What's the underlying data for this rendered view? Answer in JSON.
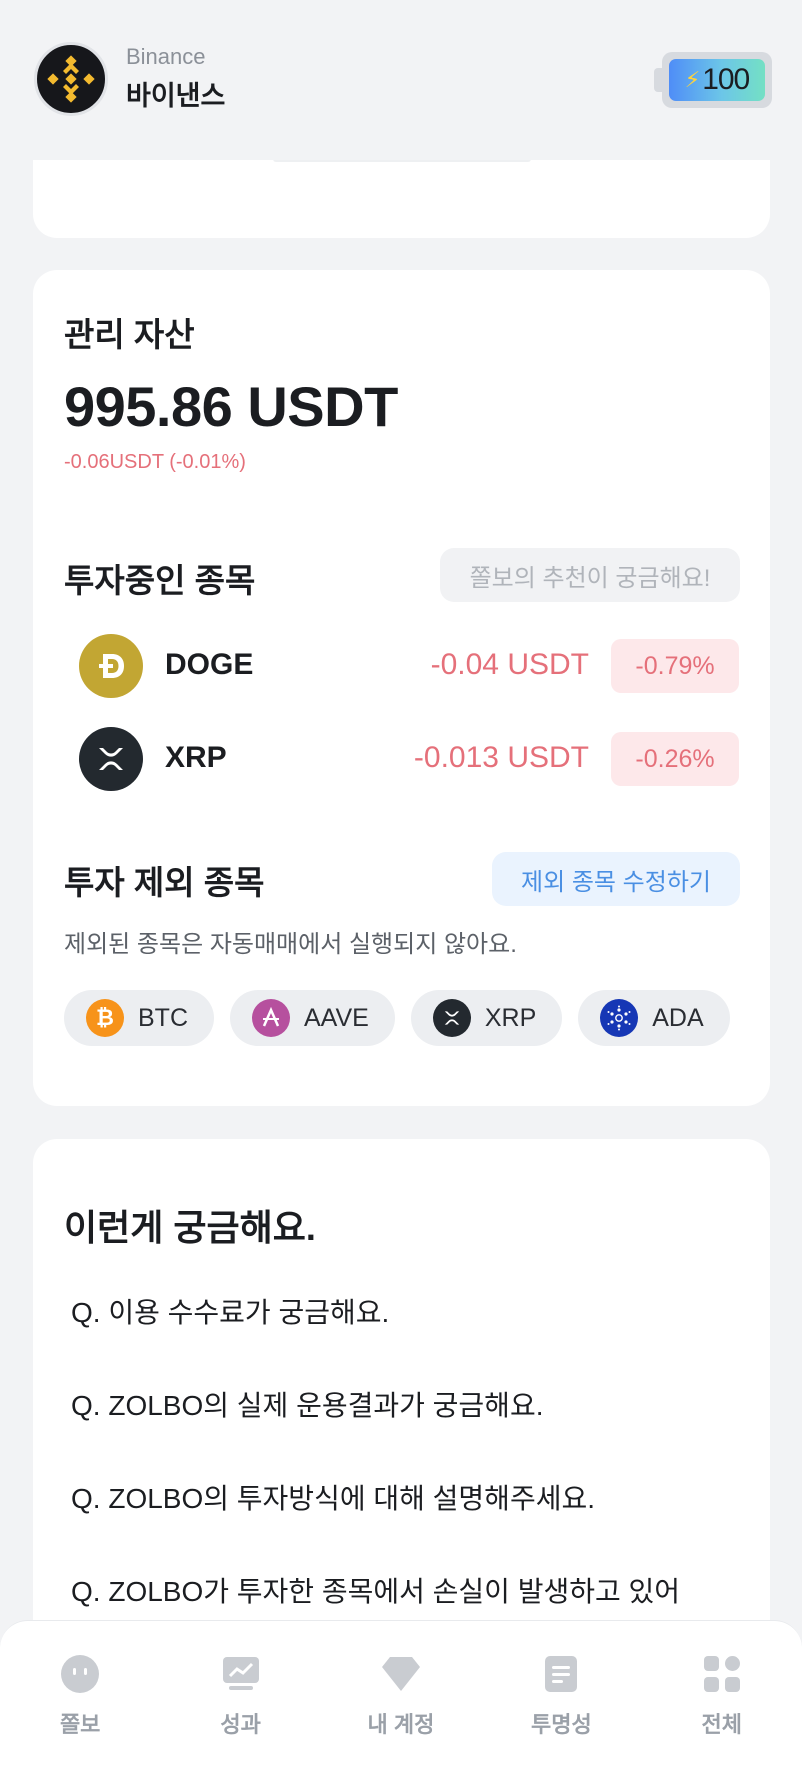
{
  "header": {
    "exchange_en": "Binance",
    "exchange_ko": "바이낸스",
    "energy_value": "100",
    "colors": {
      "brand": "#f3ba2f",
      "energy_start": "#4f8df7",
      "energy_end": "#74e0c4"
    }
  },
  "assets": {
    "title": "관리 자산",
    "amount": "995.86 USDT",
    "change": "-0.06USDT (-0.01%)"
  },
  "investing": {
    "title": "투자중인 종목",
    "recommend_button": "쫄보의 추천이 궁금해요!",
    "coins": [
      {
        "name": "DOGE",
        "amount": "-0.04 USDT",
        "percent": "-0.79%",
        "icon": "doge-icon"
      },
      {
        "name": "XRP",
        "amount": "-0.013 USDT",
        "percent": "-0.26%",
        "icon": "xrp-icon"
      }
    ],
    "negative_color": "#e5707a"
  },
  "excluded": {
    "title": "투자 제외 종목",
    "edit_button": "제외 종목 수정하기",
    "description": "제외된 종목은 자동매매에서 실행되지 않아요.",
    "chips": [
      {
        "label": "BTC",
        "icon": "btc-icon"
      },
      {
        "label": "AAVE",
        "icon": "aave-icon"
      },
      {
        "label": "XRP",
        "icon": "xrp-icon"
      },
      {
        "label": "ADA",
        "icon": "ada-icon"
      }
    ]
  },
  "faq": {
    "title": "이런게 궁금해요.",
    "items": [
      "Q. 이용 수수료가 궁금해요.",
      "Q. ZOLBO의 실제 운용결과가 궁금해요.",
      "Q. ZOLBO의 투자방식에 대해 설명해주세요.",
      "Q. ZOLBO가 투자한 종목에서 손실이 발생하고 있어"
    ]
  },
  "bottom_nav": {
    "items": [
      {
        "label": "쫄보",
        "icon": "zolbo-face-icon"
      },
      {
        "label": "성과",
        "icon": "chart-icon"
      },
      {
        "label": "내 계정",
        "icon": "gem-icon"
      },
      {
        "label": "투명성",
        "icon": "document-icon"
      },
      {
        "label": "전체",
        "icon": "grid-icon"
      }
    ]
  }
}
